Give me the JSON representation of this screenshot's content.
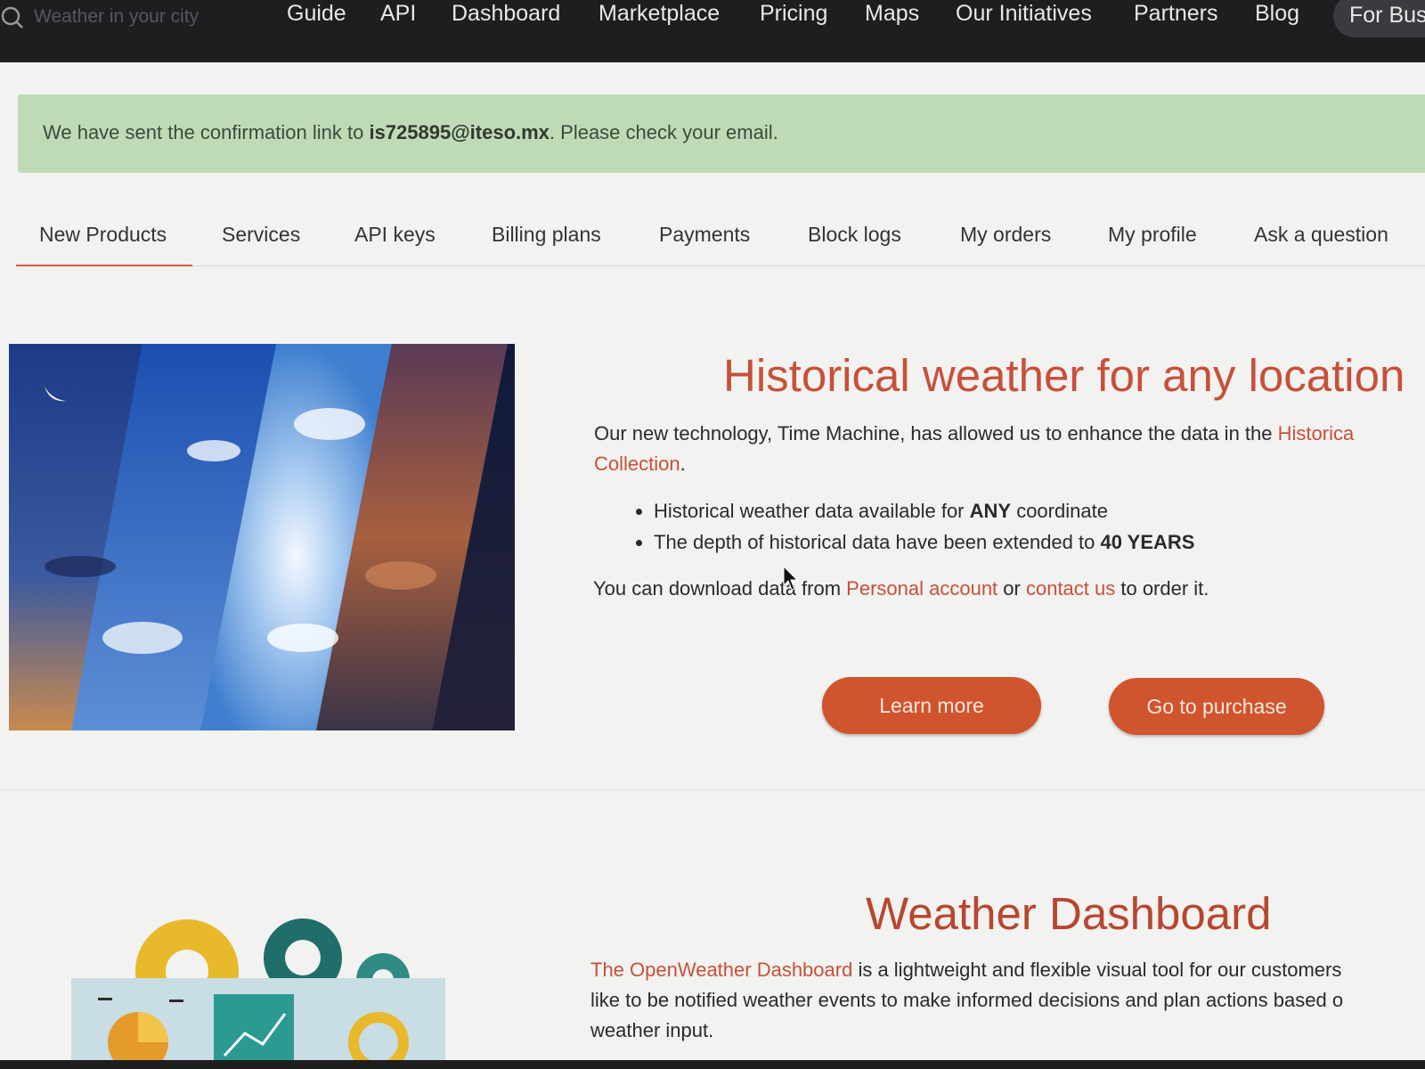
{
  "search": {
    "placeholder": "Weather in your city"
  },
  "nav": {
    "items": [
      "Guide",
      "API",
      "Dashboard",
      "Marketplace",
      "Pricing",
      "Maps",
      "Our Initiatives",
      "Partners",
      "Blog"
    ],
    "business_pill": "For Bus"
  },
  "alert": {
    "prefix": "We have sent the confirmation link to ",
    "email": "is725895@iteso.mx",
    "suffix": ". Please check your email."
  },
  "tabs": {
    "items": [
      "New Products",
      "Services",
      "API keys",
      "Billing plans",
      "Payments",
      "Block logs",
      "My orders",
      "My profile",
      "Ask a question"
    ],
    "active": "New Products"
  },
  "historical": {
    "title": "Historical weather for any location",
    "intro_text": "Our new technology, Time Machine, has allowed us to enhance the data in the ",
    "intro_link_line1": "Historica",
    "intro_link_line2": "Collection",
    "intro_end": ".",
    "bullet1_pre": "Historical weather data available for ",
    "bullet1_bold": "ANY",
    "bullet1_post": " coordinate",
    "bullet2_pre": "The depth of historical data have been extended to ",
    "bullet2_bold": "40 YEARS",
    "download_pre": "You can download data from ",
    "download_link1": "Personal account",
    "download_mid": " or ",
    "download_link2": "contact us",
    "download_post": " to order it.",
    "learn_more": "Learn more",
    "go_to_purchase": "Go to purchase"
  },
  "dashboard": {
    "title": "Weather Dashboard",
    "link": "The OpenWeather Dashboard",
    "line1_rest": " is a lightweight and flexible visual tool for our customers",
    "line2": "like to be notified weather events to make informed decisions and plan actions based o",
    "line3": "weather input."
  },
  "colors": {
    "accent": "#c8503a",
    "button": "#d0542e",
    "alert_bg": "#bfdbb6",
    "topbar": "#1e1e20"
  }
}
